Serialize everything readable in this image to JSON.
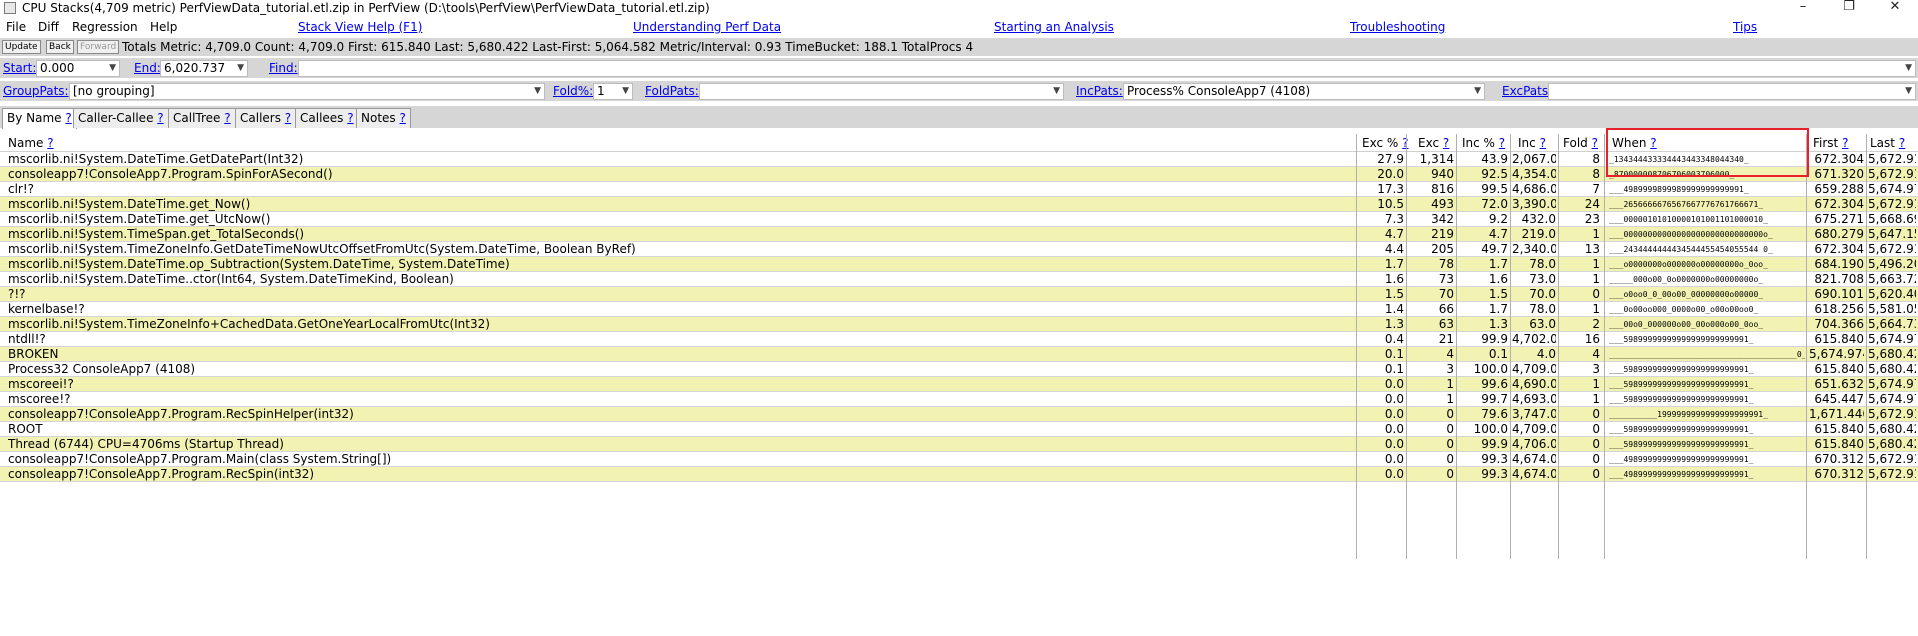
{
  "window": {
    "title": "CPU Stacks(4,709 metric) PerfViewData_tutorial.etl.zip in PerfView (D:\\tools\\PerfView\\PerfViewData_tutorial.etl.zip)",
    "minimize": "–",
    "maximize": "❐",
    "close": "✕"
  },
  "menu": [
    "File",
    "Diff",
    "Regression",
    "Help"
  ],
  "help_links": [
    "Stack View Help (F1)",
    "Understanding Perf Data",
    "Starting an Analysis",
    "Troubleshooting",
    "Tips"
  ],
  "toolbar": {
    "update": "Update",
    "back": "Back",
    "forward": "Forward",
    "totals": "Totals Metric: 4,709.0  Count: 4,709.0  First: 615.840 Last: 5,680.422  Last-First: 5,064.582  Metric/Interval: 0.93  TimeBucket: 188.1  TotalProcs 4"
  },
  "filters": {
    "start_label": "Start:",
    "start_value": "0.000",
    "end_label": "End:",
    "end_value": "6,020.737",
    "find_label": "Find:",
    "find_value": "",
    "grouppats_label": "GroupPats:",
    "grouppats_value": "[no grouping]",
    "fold_label": "Fold%:",
    "fold_value": "1",
    "foldpats_label": "FoldPats:",
    "foldpats_value": "",
    "incpats_label": "IncPats:",
    "incpats_value": "Process% ConsoleApp7 (4108)",
    "excpats_label": "ExcPats:",
    "excpats_value": ""
  },
  "tabs": [
    "By Name",
    "Caller-Callee",
    "CallTree",
    "Callers",
    "Callees",
    "Notes"
  ],
  "help_mark": "?",
  "columns": [
    "Name",
    "Exc %",
    "Exc",
    "Inc %",
    "Inc",
    "Fold",
    "When",
    "First",
    "Last"
  ],
  "rows": [
    [
      "mscorlib.ni!System.DateTime.GetDatePart(Int32)",
      "27.9",
      "1,314",
      "43.9",
      "2,067.0",
      "8",
      "_134344433334443443348044340_",
      "672.304",
      "5,672.91"
    ],
    [
      "consoleapp7!ConsoleApp7.Program.SpinForASecond()",
      "20.0",
      "940",
      "92.5",
      "4,354.0",
      "8",
      "_870000008706706003706000_",
      "671.320",
      "5,672.91"
    ],
    [
      "clr!?",
      "17.3",
      "816",
      "99.5",
      "4,686.0",
      "7",
      "___4989999899989999999999991_",
      "659.288",
      "5,674.97"
    ],
    [
      "mscorlib.ni!System.DateTime.get_Now()",
      "10.5",
      "493",
      "72.0",
      "3,390.0",
      "24",
      "___2656666676567667776761766671_",
      "672.304",
      "5,672.91"
    ],
    [
      "mscorlib.ni!System.DateTime.get_UtcNow()",
      "7.3",
      "342",
      "9.2",
      "432.0",
      "23",
      "___00000101010000101001101000010_",
      "675.271",
      "5,668.69"
    ],
    [
      "mscorlib.ni!System.TimeSpan.get_TotalSeconds()",
      "4.7",
      "219",
      "4.7",
      "219.0",
      "1",
      "___00000000000000000000000000000o_",
      "680.279",
      "5,647.15"
    ],
    [
      "mscorlib.ni!System.TimeZoneInfo.GetDateTimeNowUtcOffsetFromUtc(System.DateTime, Boolean ByRef)",
      "4.4",
      "205",
      "49.7",
      "2,340.0",
      "13",
      "___2434444444434544455454055544 0_",
      "672.304",
      "5,672.91"
    ],
    [
      "mscorlib.ni!System.DateTime.op_Subtraction(System.DateTime, System.DateTime)",
      "1.7",
      "78",
      "1.7",
      "78.0",
      "1",
      "___o0000000o000000o00000000o_0oo_",
      "684.190",
      "5,496.20"
    ],
    [
      "mscorlib.ni!System.DateTime..ctor(Int64, System.DateTimeKind, Boolean)",
      "1.6",
      "73",
      "1.6",
      "73.0",
      "1",
      "_____000o00_0o0000000o00000000o_",
      "821.708",
      "5,663.72"
    ],
    [
      "?!?",
      "1.5",
      "70",
      "1.5",
      "70.0",
      "0",
      "___o0oo0_0_00o00_00000000o00000_",
      "690.101",
      "5,620.40"
    ],
    [
      "kernelbase!?",
      "1.4",
      "66",
      "1.7",
      "78.0",
      "1",
      "___0o00oo000_0000o00_o00o00oo0_",
      "618.256",
      "5,581.05"
    ],
    [
      "mscorlib.ni!System.TimeZoneInfo+CachedData.GetOneYearLocalFromUtc(Int32)",
      "1.3",
      "63",
      "1.3",
      "63.0",
      "2",
      "___00o0_000000o00_00o000o00_0oo_",
      "704.366",
      "5,664.73"
    ],
    [
      "ntdll!?",
      "0.4",
      "21",
      "99.9",
      "4,702.0",
      "16",
      "___59899999999999999999999991_",
      "615.840",
      "5,674.97"
    ],
    [
      "BROKEN",
      "0.1",
      "4",
      "0.1",
      "4.0",
      "4",
      "_______________________________________0_",
      "5,674.974",
      "5,680.42"
    ],
    [
      "Process32 ConsoleApp7 (4108)",
      "0.1",
      "3",
      "100.0",
      "4,709.0",
      "3",
      "___59899999999999999999999991_",
      "615.840",
      "5,680.42"
    ],
    [
      "mscoreei!?",
      "0.0",
      "1",
      "99.6",
      "4,690.0",
      "1",
      "___59899999999999999999999991_",
      "651.632",
      "5,674.97"
    ],
    [
      "mscoree!?",
      "0.0",
      "1",
      "99.7",
      "4,693.0",
      "1",
      "___59899999999999999999999991_",
      "645.447",
      "5,674.97"
    ],
    [
      "consoleapp7!ConsoleApp7.Program.RecSpinHelper(int32)",
      "0.0",
      "0",
      "79.6",
      "3,747.0",
      "0",
      "__________1999999999999999999991_",
      "1,671.440",
      "5,672.91"
    ],
    [
      "ROOT",
      "0.0",
      "0",
      "100.0",
      "4,709.0",
      "0",
      "___59899999999999999999999991_",
      "615.840",
      "5,680.42"
    ],
    [
      "Thread (6744) CPU=4706ms (Startup Thread)",
      "0.0",
      "0",
      "99.9",
      "4,706.0",
      "0",
      "___59899999999999999999999991_",
      "615.840",
      "5,680.42"
    ],
    [
      "consoleapp7!ConsoleApp7.Program.Main(class System.String[])",
      "0.0",
      "0",
      "99.3",
      "4,674.0",
      "0",
      "___49899999999999999999999991_",
      "670.312",
      "5,672.91"
    ],
    [
      "consoleapp7!ConsoleApp7.Program.RecSpin(int32)",
      "0.0",
      "0",
      "99.3",
      "4,674.0",
      "0",
      "___49899999999999999999999991_",
      "670.312",
      "5,672.91"
    ]
  ],
  "colors": {
    "row_alt": "#f2f2b3",
    "toolbar_bg": "#d6d6d6",
    "link": "#0000ee",
    "highlight_box": "#e8202a"
  }
}
